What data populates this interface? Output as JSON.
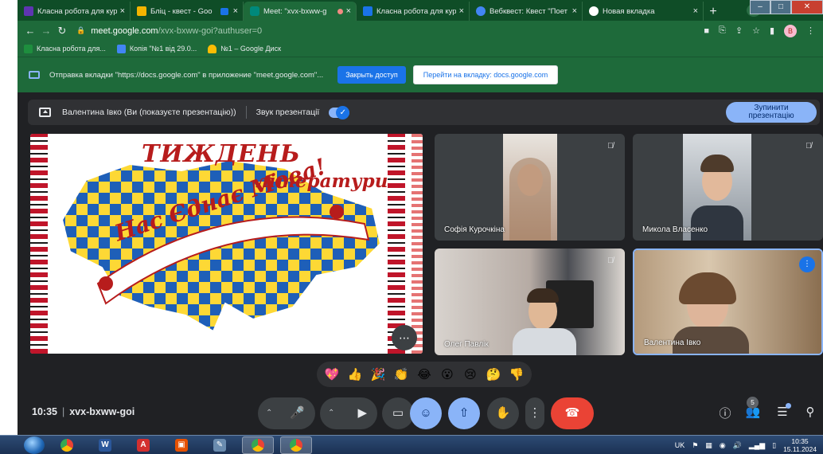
{
  "browser": {
    "tabs": [
      {
        "label": "Класна робота для кур",
        "color": "#5e35b1",
        "active": false
      },
      {
        "label": "Бліц - квест - Goo",
        "color": "#f4b400",
        "active": false
      },
      {
        "label": "Meet: \"xvx-bxww-g",
        "color": "#00897b",
        "active": true
      },
      {
        "label": "Класна робота для кур",
        "color": "#1a73e8",
        "active": false
      },
      {
        "label": "Вебквест: Квест \"Поет",
        "color": "#4285f4",
        "active": false
      },
      {
        "label": "Новая вкладка",
        "color": "#ffffff",
        "active": false
      }
    ],
    "tab_close": "×",
    "new_tab": "+",
    "address": {
      "host": "meet.google.com",
      "path": "/xvx-bxww-goi?authuser=0"
    },
    "profile_letter": "B",
    "bookmarks": [
      {
        "label": "Класна робота для...",
        "color": "#1e8e3e"
      },
      {
        "label": "Копія \"№1 від 29.0...",
        "color": "#4285f4"
      },
      {
        "label": "№1 – Google Диск",
        "color": "#fbbc04"
      }
    ],
    "infobar": {
      "message": "Отправка вкладки \"https://docs.google.com\" в приложение \"meet.google.com\"...",
      "close_access": "Закрыть доступ",
      "go_to_tab": "Перейти на вкладку: docs.google.com"
    }
  },
  "meet": {
    "presenting": {
      "text": "Валентина Івко (Ви (показуєте презентацію))",
      "sound_label": "Звук презентації",
      "stop_label_1": "Зупинити",
      "stop_label_2": "презентацію"
    },
    "slide": {
      "title": "ТИЖДЕНЬ",
      "subtitle": "літератури",
      "motto": "Нас Єднає Мова!"
    },
    "participants": [
      {
        "name": "Софія Курочкіна",
        "muted": true,
        "speaking": false
      },
      {
        "name": "Микола Власенко",
        "muted": true,
        "speaking": false
      },
      {
        "name": "Олег Павлік",
        "muted": true,
        "speaking": false
      },
      {
        "name": "Валентина Івко",
        "muted": false,
        "speaking": true
      }
    ],
    "reactions": [
      "💖",
      "👍",
      "🎉",
      "👏",
      "😂",
      "😮",
      "😢",
      "🤔",
      "👎"
    ],
    "controls": {
      "time": "10:35",
      "separator": "|",
      "meeting_code": "xvx-bxww-goi",
      "participants_count": "5"
    }
  },
  "taskbar": {
    "lang": "UK",
    "time": "10:35",
    "date": "15.11.2024"
  },
  "colors": {
    "chrome_green": "#1e6a3a",
    "meet_bg": "#202124",
    "accent_blue": "#8ab4f8",
    "end_call": "#ea4335"
  }
}
